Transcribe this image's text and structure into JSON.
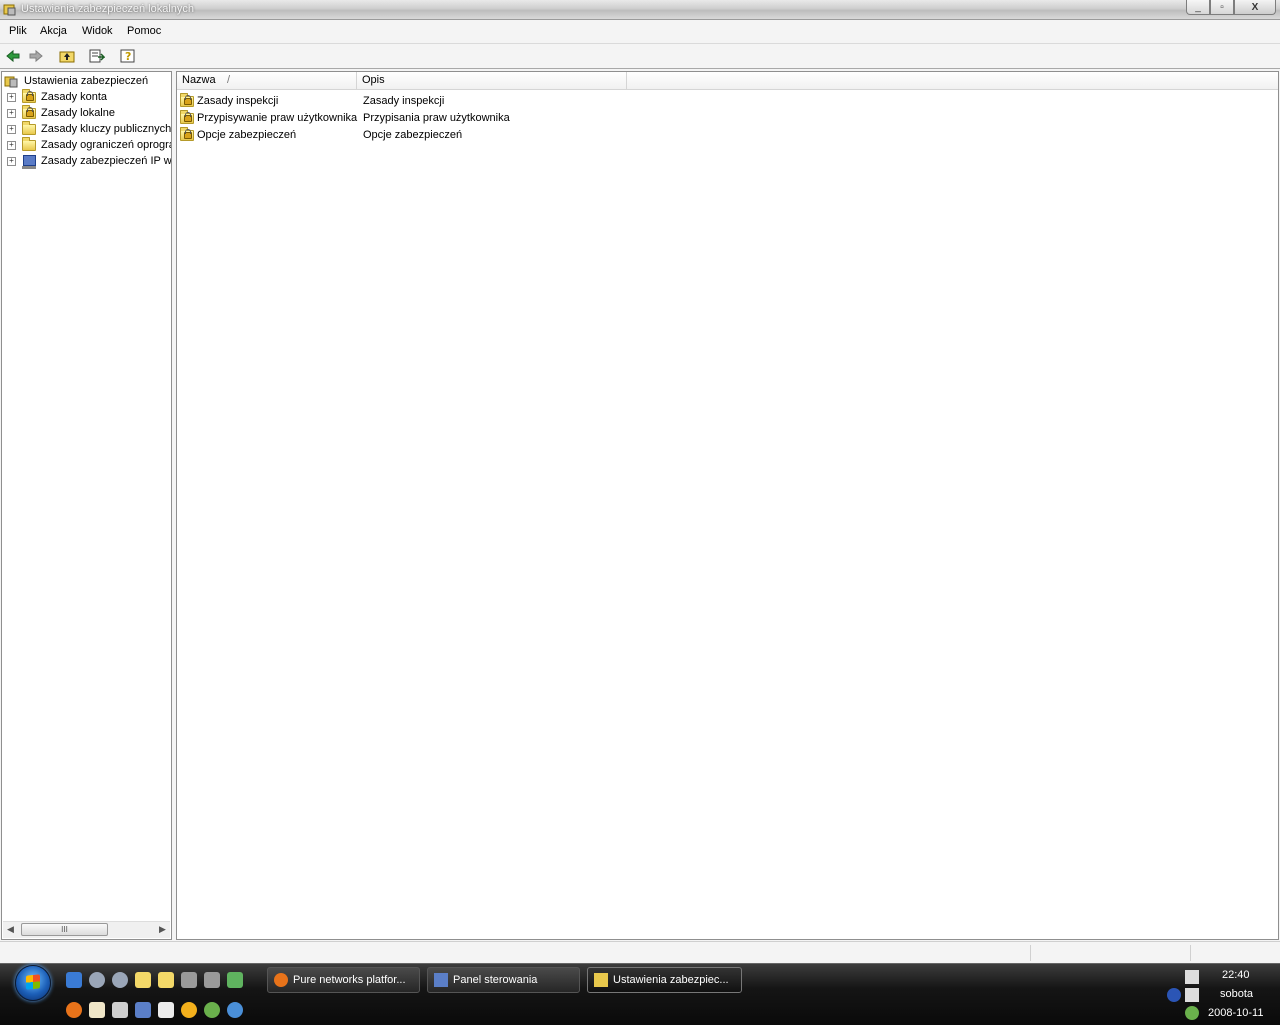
{
  "window": {
    "title": "Ustawienia zabezpieczeń lokalnych",
    "controls": {
      "minimize": "_",
      "maximize": "▫",
      "close": "X"
    }
  },
  "menu": [
    "Plik",
    "Akcja",
    "Widok",
    "Pomoc"
  ],
  "toolbar": {
    "icons": [
      "back-arrow-icon",
      "forward-arrow-icon",
      "up-folder-icon",
      "export-list-icon",
      "help-icon"
    ]
  },
  "tree": {
    "root": "Ustawienia zabezpieczeń",
    "items": [
      {
        "label": "Zasady konta",
        "icon": "folder-lock-icon",
        "expander": "+"
      },
      {
        "label": "Zasady lokalne",
        "icon": "folder-lock-icon",
        "expander": "+"
      },
      {
        "label": "Zasady kluczy publicznych",
        "icon": "folder-icon",
        "expander": "+"
      },
      {
        "label": "Zasady ograniczeń oprogra",
        "icon": "folder-icon",
        "expander": "+"
      },
      {
        "label": "Zasady zabezpieczeń IP w",
        "icon": "computer-icon",
        "expander": "+"
      }
    ],
    "scrollbar": {
      "left": "◀",
      "thumb": "III",
      "right": "▶"
    }
  },
  "list": {
    "columns": {
      "name": "Nazwa",
      "sort_indicator": "/",
      "description": "Opis"
    },
    "rows": [
      {
        "name": "Zasady inspekcji",
        "description": "Zasady inspekcji"
      },
      {
        "name": "Przypisywanie praw użytkownika",
        "description": "Przypisania praw użytkownika"
      },
      {
        "name": "Opcje zabezpieczeń",
        "description": "Opcje zabezpieczeń"
      }
    ]
  },
  "taskbar": {
    "tasks": [
      {
        "label": "Pure networks platfor...",
        "icon": "firefox-icon"
      },
      {
        "label": "Panel sterowania",
        "icon": "control-panel-icon"
      },
      {
        "label": "Ustawienia zabezpiec...",
        "icon": "security-settings-icon"
      }
    ],
    "clock": {
      "time": "22:40",
      "day": "sobota",
      "date": "2008-10-11"
    }
  },
  "colors": {
    "accent": "#1c5fb8",
    "taskbar": "#151515",
    "folder": "#e8c84c"
  }
}
